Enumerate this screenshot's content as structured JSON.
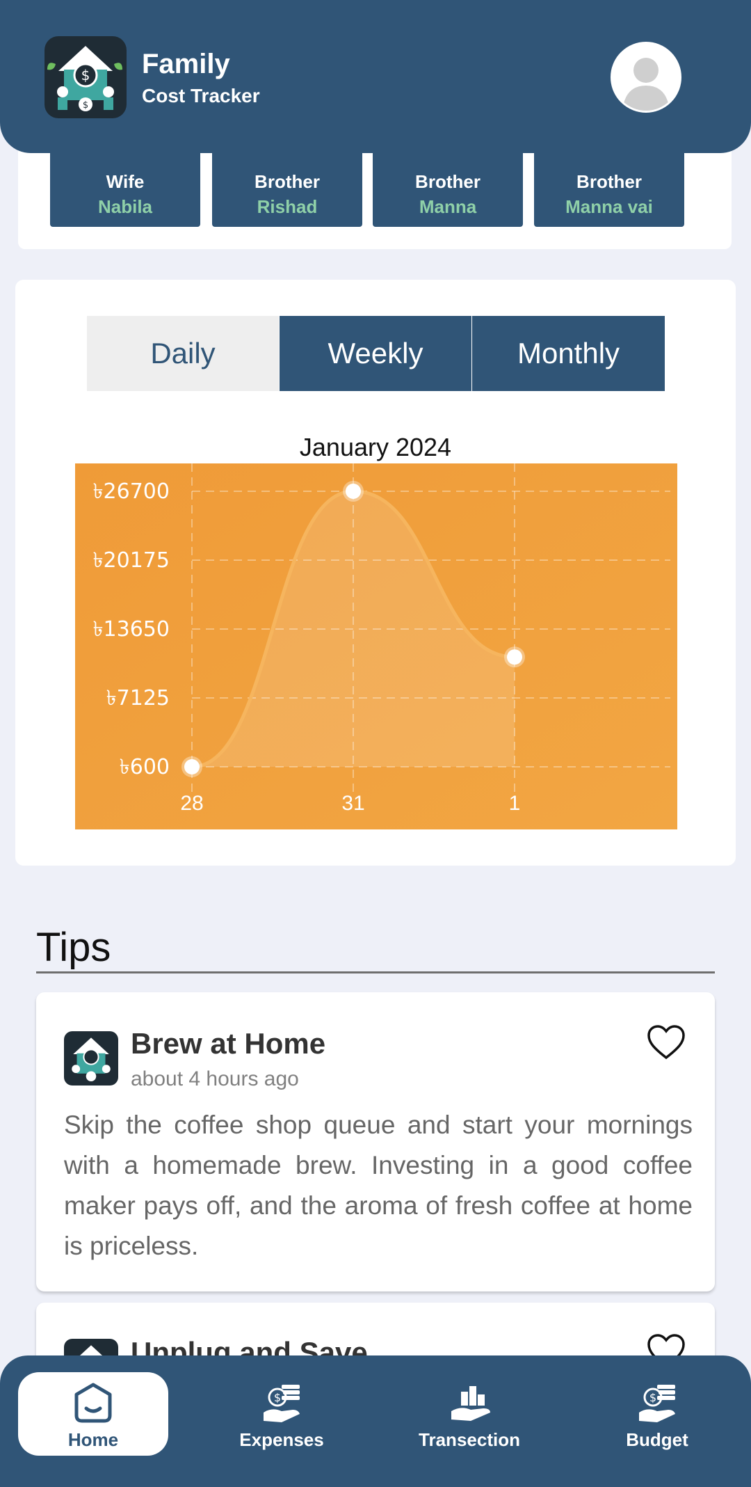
{
  "header": {
    "title": "Family",
    "subtitle": "Cost Tracker"
  },
  "members": [
    {
      "relation": "Wife",
      "name": "Nabila"
    },
    {
      "relation": "Brother",
      "name": "Rishad"
    },
    {
      "relation": "Brother",
      "name": "Manna"
    },
    {
      "relation": "Brother",
      "name": "Manna vai"
    }
  ],
  "period_tabs": {
    "daily": "Daily",
    "weekly": "Weekly",
    "monthly": "Monthly",
    "selected": "Daily"
  },
  "chart_data": {
    "type": "line",
    "title": "January 2024",
    "x": [
      "28",
      "31",
      "1"
    ],
    "values": [
      600,
      26700,
      11000
    ],
    "y_ticks": [
      "৳600",
      "৳7125",
      "৳13650",
      "৳20175",
      "৳26700"
    ],
    "ylim": [
      600,
      26700
    ],
    "grid": true,
    "colors": {
      "background": "#ef9b38",
      "line": "#f6b55e",
      "point": "#ffffff"
    }
  },
  "tips": {
    "heading": "Tips",
    "items": [
      {
        "title": "Brew at Home",
        "time": "about 4 hours ago",
        "body": "Skip the coffee shop queue and start your mornings with a homemade brew. Investing in a good coffee maker pays off, and the aroma of fresh coffee at home is priceless."
      },
      {
        "title": "Unplug and Save",
        "time": "",
        "body": ""
      }
    ]
  },
  "nav": {
    "home": "Home",
    "expenses": "Expenses",
    "transection": "Transection",
    "budget": "Budget",
    "active": "Home"
  },
  "icons": {
    "logo": "family-house-money-icon",
    "avatar": "user-silhouette-icon",
    "favorite": "heart-outline-icon",
    "home": "home-icon",
    "expenses": "hand-money-icon",
    "transection": "hand-buildings-icon",
    "budget": "hand-money-icon"
  },
  "colors": {
    "primary": "#305577",
    "accent_green": "#8fd0a8",
    "chart_orange": "#ef9b38",
    "background": "#eef0f8"
  }
}
